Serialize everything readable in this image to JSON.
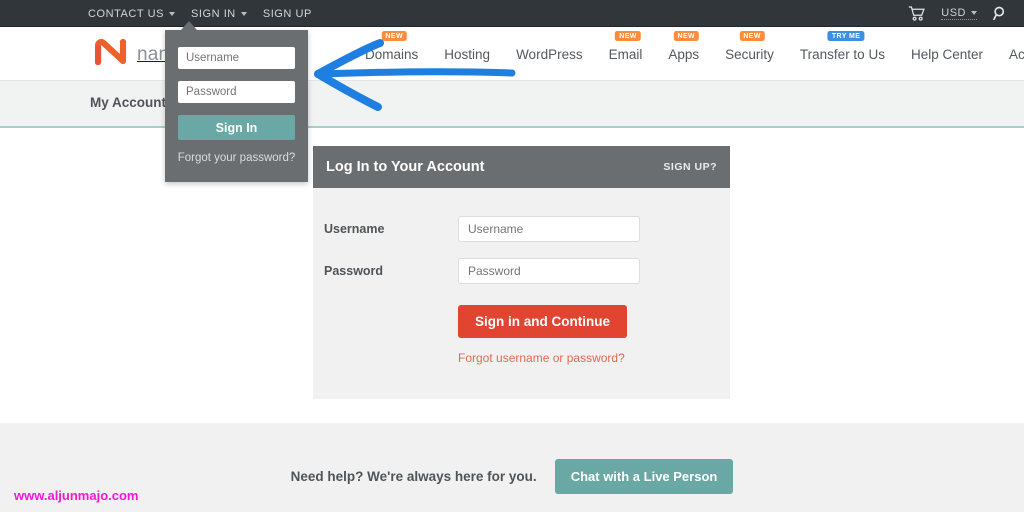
{
  "topbar": {
    "links": [
      {
        "label": "CONTACT US",
        "has_caret": true
      },
      {
        "label": "SIGN IN",
        "has_caret": true
      },
      {
        "label": "SIGN UP",
        "has_caret": false
      }
    ],
    "cart_icon": "shopping-cart-icon",
    "currency": "USD",
    "search_icon": "search-icon"
  },
  "brand": {
    "logo": "namecheap-n-logo",
    "word": "nam"
  },
  "nav": {
    "items": [
      {
        "label": "Domains",
        "badge": "NEW",
        "badge_kind": "new"
      },
      {
        "label": "Hosting",
        "badge": "",
        "badge_kind": ""
      },
      {
        "label": "WordPress",
        "badge": "",
        "badge_kind": ""
      },
      {
        "label": "Email",
        "badge": "NEW",
        "badge_kind": "new"
      },
      {
        "label": "Apps",
        "badge": "NEW",
        "badge_kind": "new"
      },
      {
        "label": "Security",
        "badge": "NEW",
        "badge_kind": "new"
      },
      {
        "label": "Transfer to Us",
        "badge": "TRY ME",
        "badge_kind": "try"
      },
      {
        "label": "Help Center",
        "badge": "",
        "badge_kind": ""
      },
      {
        "label": "Account",
        "badge": "",
        "badge_kind": ""
      }
    ]
  },
  "breadcrumb": {
    "text": "My Account –"
  },
  "signin_popover": {
    "username_placeholder": "Username",
    "username_value": "",
    "password_placeholder": "Password",
    "password_value": "",
    "signin_label": "Sign In",
    "forgot_label": "Forgot your password?"
  },
  "login_card": {
    "title": "Log In to Your Account",
    "signup_label": "SIGN UP?",
    "username_label": "Username",
    "username_placeholder": "Username",
    "username_value": "",
    "password_label": "Password",
    "password_placeholder": "Password",
    "password_value": "",
    "submit_label": "Sign in and Continue",
    "forgot_label": "Forgot username or password?"
  },
  "help": {
    "text": "Need help? We're always here for you.",
    "chat_label": "Chat with a Live Person"
  },
  "watermark": {
    "text": "www.aljunmajo.com"
  },
  "annotation": {
    "arrow": "left-pointing-arrow",
    "color": "#1f7fe0"
  },
  "colors": {
    "topbar_bg": "#31363a",
    "popover_bg": "#6b6e70",
    "teal": "#6aa8a5",
    "red": "#e14430",
    "badge_new": "#ff8c3b",
    "badge_try": "#3d8fe0",
    "brand_orange": "#f0612a",
    "watermark": "#f516d8"
  }
}
